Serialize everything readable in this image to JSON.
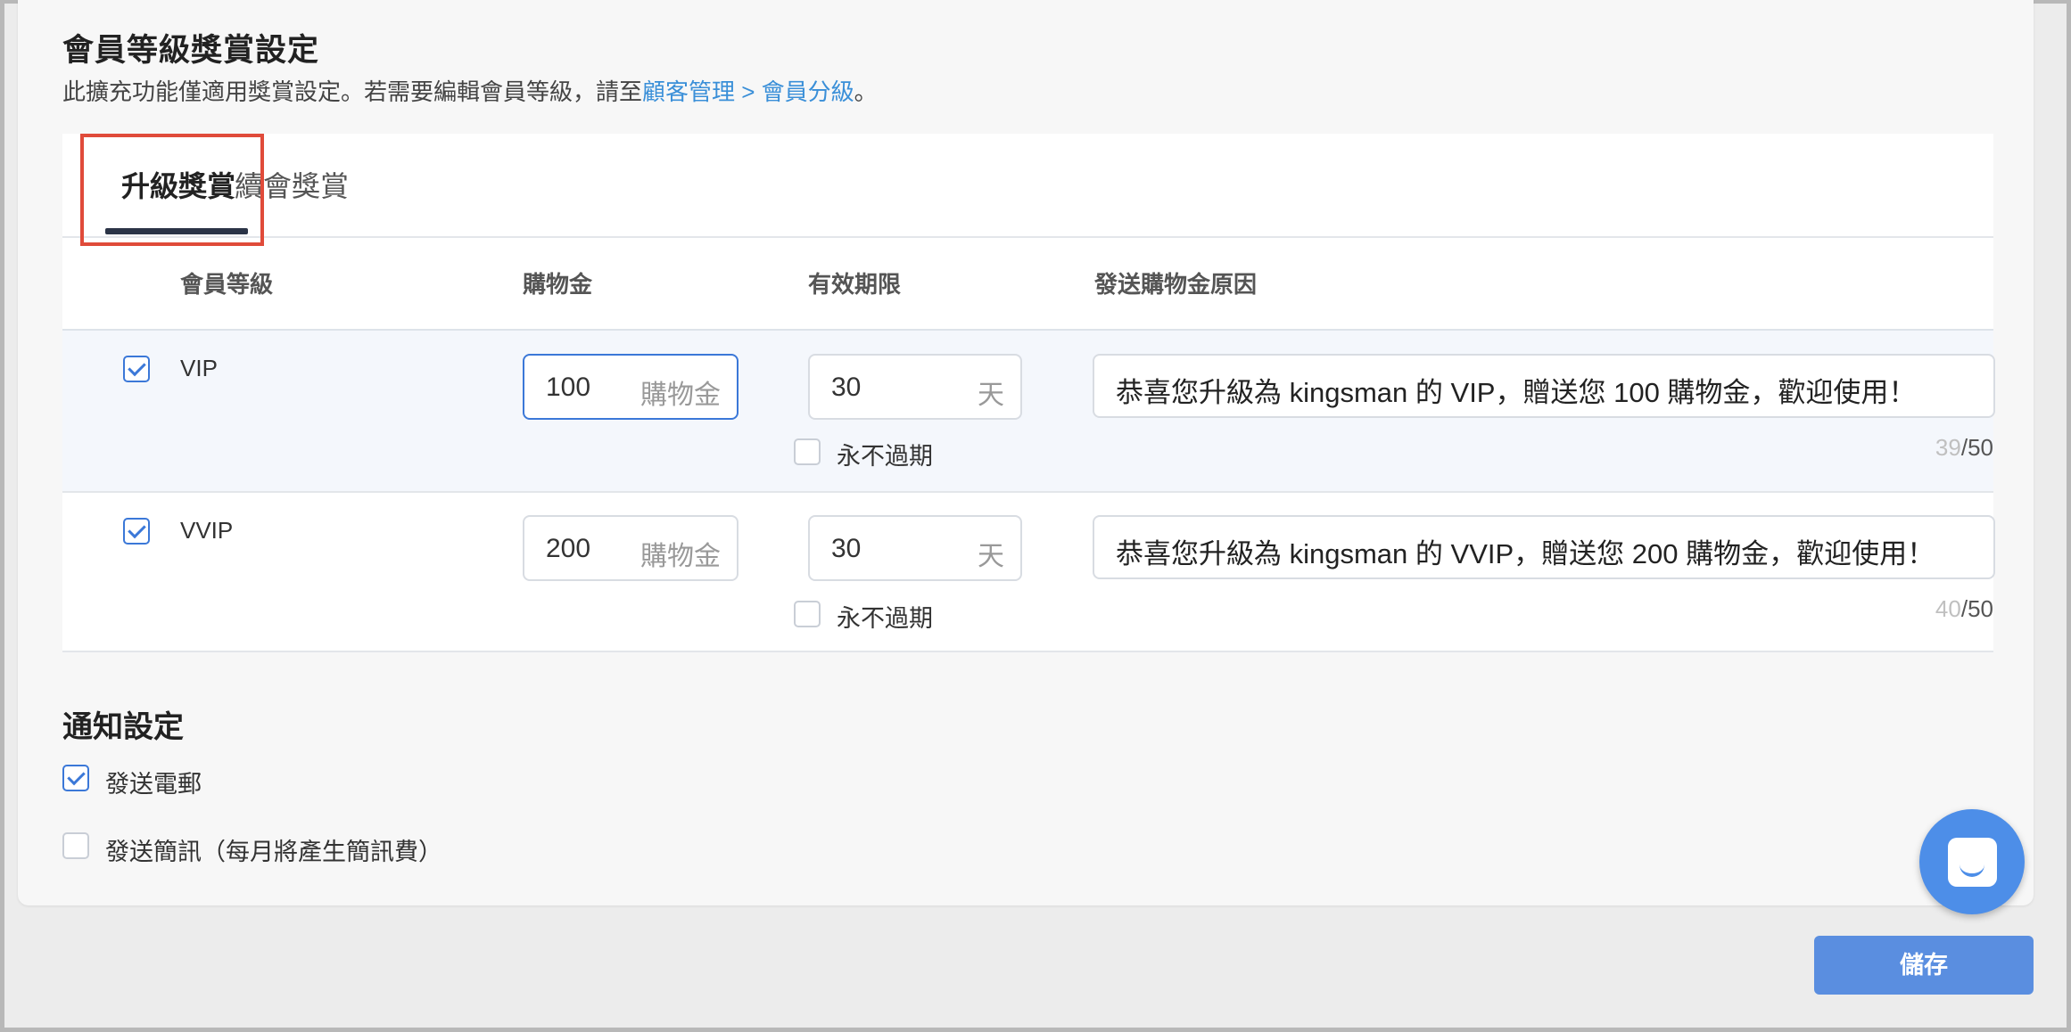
{
  "header": {
    "title": "會員等級獎賞設定",
    "subtitle_prefix": "此擴充功能僅適用獎賞設定。若需要編輯會員等級，請至",
    "subtitle_link": "顧客管理 > 會員分級",
    "subtitle_suffix": "。"
  },
  "tabs": [
    {
      "label": "升級獎賞",
      "active": true
    },
    {
      "label": "續會獎賞",
      "active": false
    }
  ],
  "table": {
    "columns": [
      "會員等級",
      "購物金",
      "有效期限",
      "發送購物金原因"
    ],
    "rows": [
      {
        "checked": true,
        "level": "VIP",
        "credit": "100",
        "credit_unit": "購物金",
        "days": "30",
        "days_unit": "天",
        "never_expire_label": "永不過期",
        "never_expire": false,
        "reason": "恭喜您升級為 kingsman 的 VIP，贈送您 100 購物金，歡迎使用！",
        "count_used": "39",
        "count_max": "/50"
      },
      {
        "checked": true,
        "level": "VVIP",
        "credit": "200",
        "credit_unit": "購物金",
        "days": "30",
        "days_unit": "天",
        "never_expire_label": "永不過期",
        "never_expire": false,
        "reason": "恭喜您升級為 kingsman 的 VVIP，贈送您 200 購物金，歡迎使用！",
        "count_used": "40",
        "count_max": "/50"
      }
    ]
  },
  "notification": {
    "title": "通知設定",
    "email_label": "發送電郵",
    "email_checked": true,
    "sms_label": "發送簡訊（每月將產生簡訊費）",
    "sms_checked": false
  },
  "actions": {
    "save_label": "儲存"
  },
  "icons": {
    "chat": "chat-bubble-icon",
    "checkbox": "checkmark-icon"
  },
  "colors": {
    "accent": "#3b78d8",
    "link": "#3a8fd8",
    "highlight": "#e04b3a",
    "save_button": "#5a8ee0"
  }
}
